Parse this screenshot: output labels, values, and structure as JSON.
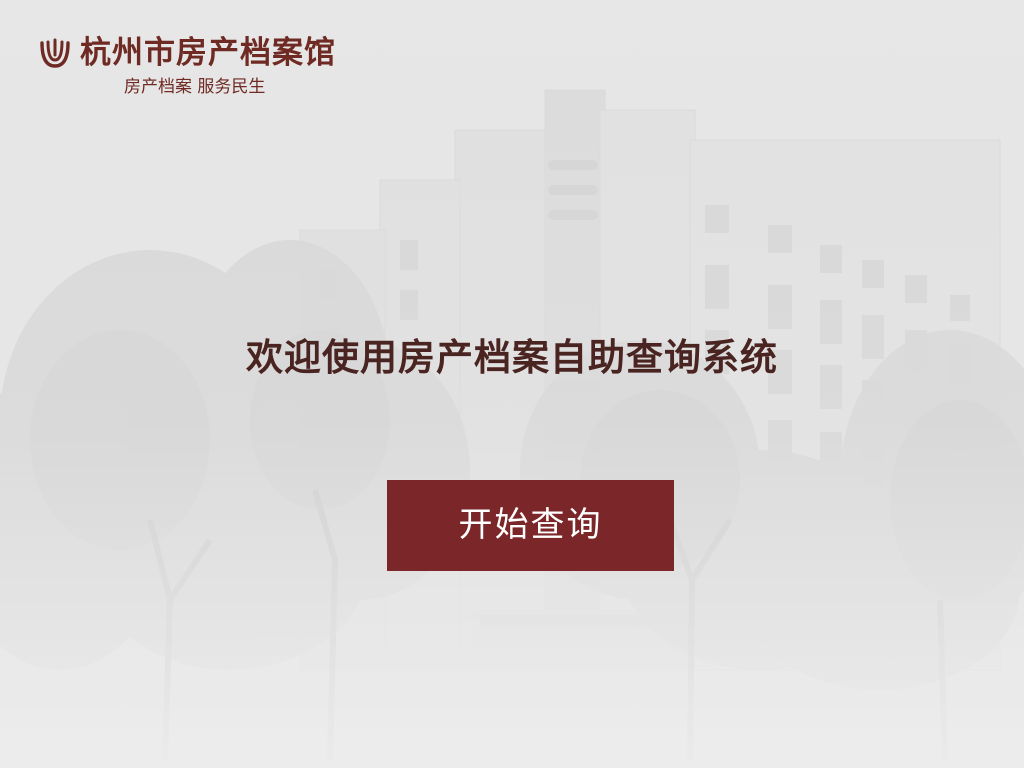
{
  "header": {
    "logo_title": "杭州市房产档案馆",
    "slogan": "房产档案 服务民生",
    "logo_icon": "archive-emblem-icon"
  },
  "main": {
    "welcome_title": "欢迎使用房产档案自助查询系统",
    "start_button_label": "开始查询"
  },
  "background": {
    "description_icon": "building-photo-background"
  },
  "colors": {
    "brand": "#6e2a23",
    "button": "#7b2628",
    "title": "#4a2421",
    "background": "#e6e5e6"
  }
}
